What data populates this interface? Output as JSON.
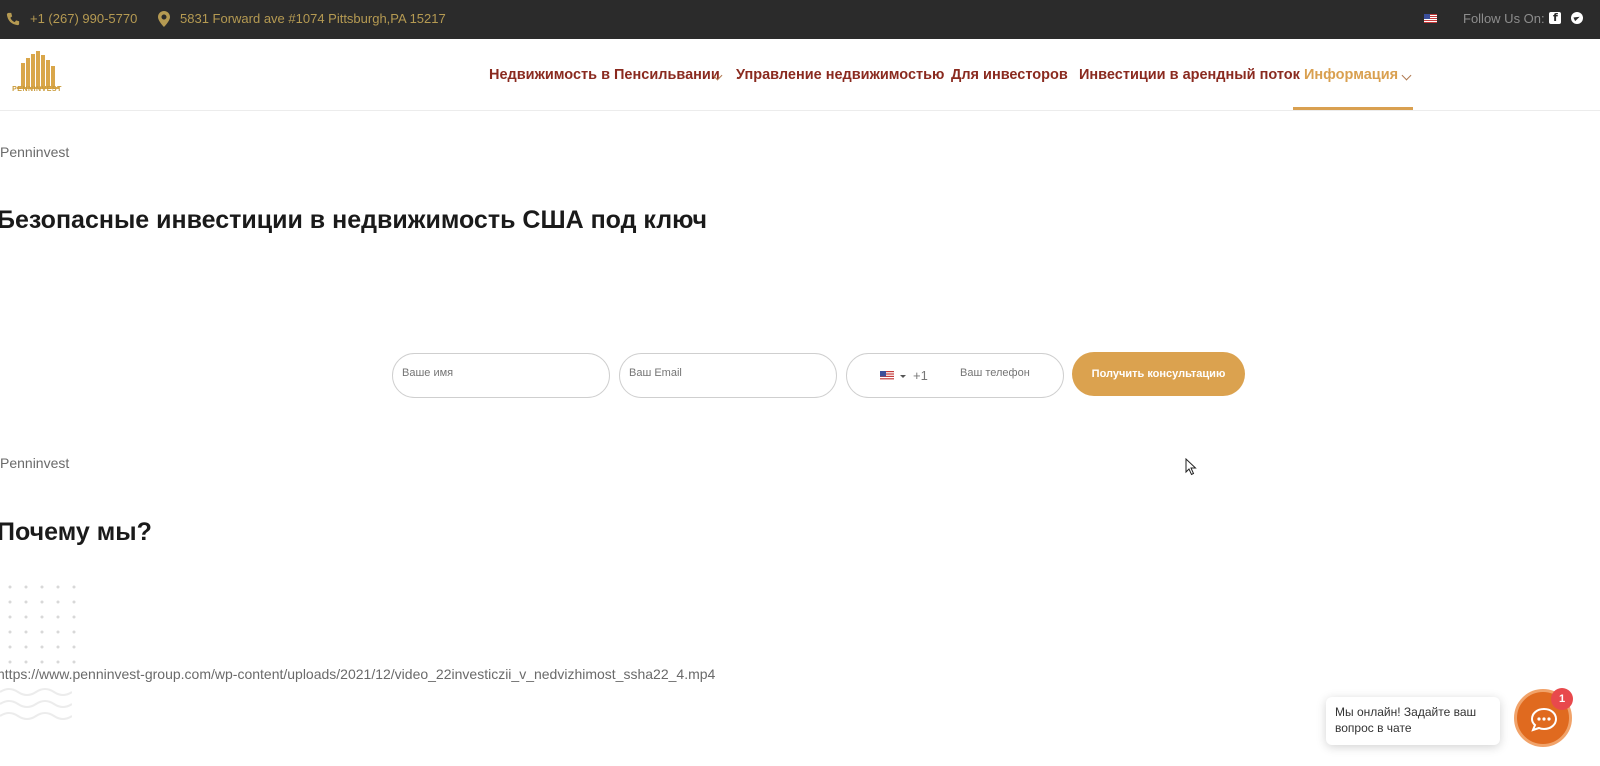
{
  "topbar": {
    "phone": "+1 (267) 990-5770",
    "address": "5831 Forward ave #1074 Pittsburgh,PA 15217",
    "follow_label": "Follow Us On:"
  },
  "header": {
    "logo_text": "PENNINVEST",
    "nav": [
      {
        "label": "Недвижимость в Пенсильвании",
        "has_dropdown": true
      },
      {
        "label": "Управление недвижимостью",
        "has_dropdown": false
      },
      {
        "label": "Для инвесторов",
        "has_dropdown": false
      },
      {
        "label": "Инвестиции в арендный поток",
        "has_dropdown": false
      },
      {
        "label": "Информация",
        "has_dropdown": true,
        "active": true
      }
    ]
  },
  "section1": {
    "breadcrumb": "Penninvest",
    "title": "Безопасные инвестиции в недвижимость США под ключ"
  },
  "form": {
    "name_placeholder": "Ваше имя",
    "email_placeholder": "Ваш Email",
    "phone_code": "+1",
    "phone_placeholder": "Ваш телефон",
    "submit_label": "Получить консультацию"
  },
  "section2": {
    "breadcrumb": "Penninvest",
    "title": "Почему мы?",
    "video_url": "https://www.penninvest-group.com/wp-content/uploads/2021/12/video_22investiczii_v_nedvizhimost_ssha22_4.mp4"
  },
  "chat": {
    "message": "Мы онлайн! Задайте ваш вопрос в чате",
    "badge_count": "1"
  },
  "colors": {
    "topbar_bg": "#2b2b2b",
    "nav_text": "#8a2a1f",
    "accent_gold": "#d9a050",
    "chat_orange": "#e06a1f"
  }
}
